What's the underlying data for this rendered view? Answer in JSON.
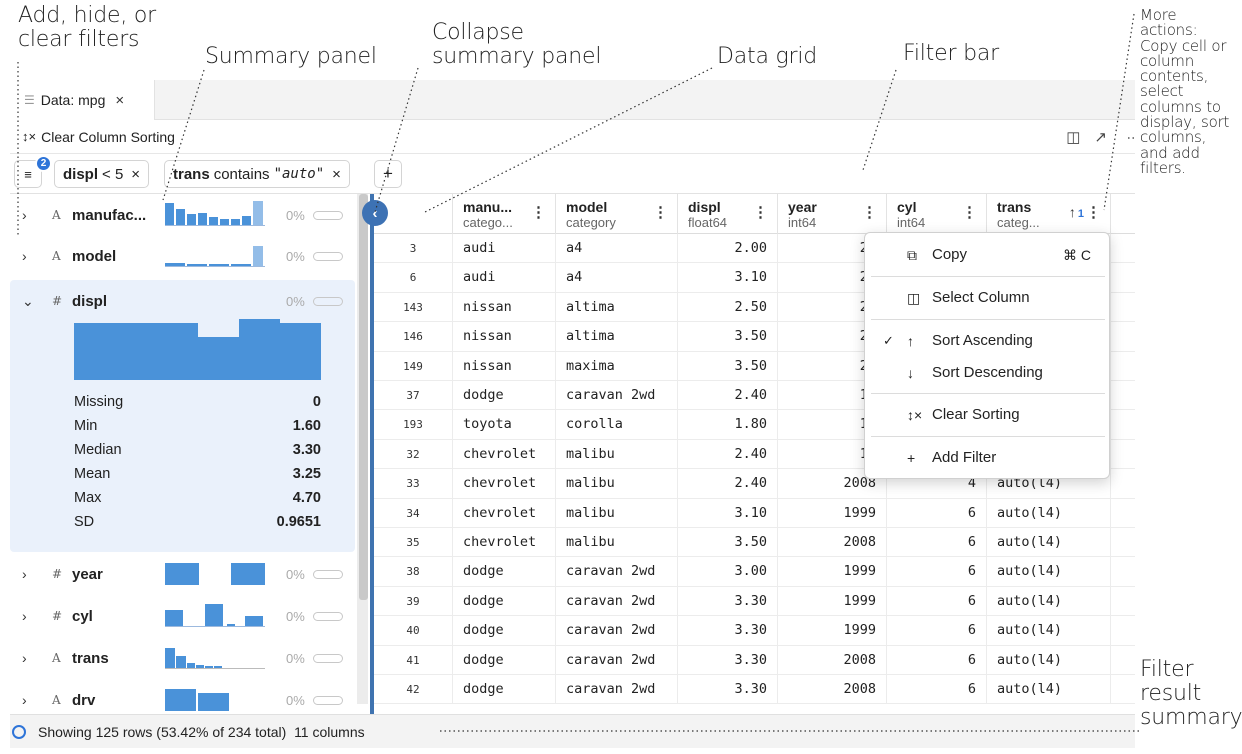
{
  "annotations": {
    "add_hide_filters": [
      "Add, hide, or",
      "clear filters"
    ],
    "summary_panel": "Summary panel",
    "collapse_summary": [
      "Collapse",
      "summary panel"
    ],
    "data_grid": "Data grid",
    "filter_bar": "Filter bar",
    "more_actions": [
      "More",
      "actions:",
      "Copy cell or",
      "column",
      "contents,",
      "select",
      "columns to",
      "display, sort",
      "columns,",
      "and add",
      "filters."
    ],
    "filter_result_summary": [
      "Filter",
      "result",
      "summary"
    ]
  },
  "tab": {
    "icon": "table-icon",
    "label": "Data: mpg",
    "close": "×"
  },
  "toolbar": {
    "clear_sorting_icon": "↕×",
    "clear_sorting_label": "Clear Column Sorting",
    "split_icon": "◫",
    "popout_icon": "↗"
  },
  "filter_bar": {
    "filter_count": "2",
    "filters": [
      {
        "column": "displ",
        "rest": "< 5",
        "value": ""
      },
      {
        "column": "trans",
        "rest": "contains",
        "value": "\"auto\""
      }
    ],
    "remove": "×",
    "add": "+"
  },
  "summary": {
    "columns": [
      {
        "name": "manufac...",
        "type": "A",
        "missing": "0%",
        "chevron": "›"
      },
      {
        "name": "model",
        "type": "A",
        "missing": "0%",
        "chevron": "›"
      },
      {
        "name": "displ",
        "type": "#",
        "missing": "0%",
        "chevron": "⌄"
      },
      {
        "name": "year",
        "type": "#",
        "missing": "0%",
        "chevron": "›"
      },
      {
        "name": "cyl",
        "type": "#",
        "missing": "0%",
        "chevron": "›"
      },
      {
        "name": "trans",
        "type": "A",
        "missing": "0%",
        "chevron": "›"
      },
      {
        "name": "drv",
        "type": "A",
        "missing": "0%",
        "chevron": "›"
      }
    ],
    "displ_histogram": [
      0.62,
      0.62,
      0.62,
      0.47,
      0.67,
      0.62
    ],
    "displ_stats": [
      {
        "label": "Missing",
        "value": "0"
      },
      {
        "label": "Min",
        "value": "1.60"
      },
      {
        "label": "Median",
        "value": "3.30"
      },
      {
        "label": "Mean",
        "value": "3.25"
      },
      {
        "label": "Max",
        "value": "4.70"
      },
      {
        "label": "SD",
        "value": "0.9651"
      }
    ]
  },
  "grid": {
    "columns": [
      {
        "name": "manu...",
        "type": "catego...",
        "menu": "⋮"
      },
      {
        "name": "model",
        "type": "category",
        "menu": "⋮"
      },
      {
        "name": "displ",
        "type": "float64",
        "menu": "⋮"
      },
      {
        "name": "year",
        "type": "int64",
        "menu": "⋮"
      },
      {
        "name": "cyl",
        "type": "int64",
        "menu": "⋮"
      },
      {
        "name": "trans",
        "type": "categ...",
        "menu": "⋮",
        "sort": "↑",
        "sort_rank": "1"
      }
    ],
    "rows": [
      [
        "3",
        "audi",
        "a4",
        "2.00",
        "20",
        "",
        ""
      ],
      [
        "6",
        "audi",
        "a4",
        "3.10",
        "20",
        "",
        ""
      ],
      [
        "143",
        "nissan",
        "altima",
        "2.50",
        "20",
        "",
        ""
      ],
      [
        "146",
        "nissan",
        "altima",
        "3.50",
        "20",
        "",
        ""
      ],
      [
        "149",
        "nissan",
        "maxima",
        "3.50",
        "20",
        "",
        ""
      ],
      [
        "37",
        "dodge",
        "caravan 2wd",
        "2.40",
        "19",
        "",
        ""
      ],
      [
        "193",
        "toyota",
        "corolla",
        "1.80",
        "19",
        "",
        ""
      ],
      [
        "32",
        "chevrolet",
        "malibu",
        "2.40",
        "19",
        "",
        ""
      ],
      [
        "33",
        "chevrolet",
        "malibu",
        "2.40",
        "2008",
        "4",
        "auto(l4)"
      ],
      [
        "34",
        "chevrolet",
        "malibu",
        "3.10",
        "1999",
        "6",
        "auto(l4)"
      ],
      [
        "35",
        "chevrolet",
        "malibu",
        "3.50",
        "2008",
        "6",
        "auto(l4)"
      ],
      [
        "38",
        "dodge",
        "caravan 2wd",
        "3.00",
        "1999",
        "6",
        "auto(l4)"
      ],
      [
        "39",
        "dodge",
        "caravan 2wd",
        "3.30",
        "1999",
        "6",
        "auto(l4)"
      ],
      [
        "40",
        "dodge",
        "caravan 2wd",
        "3.30",
        "1999",
        "6",
        "auto(l4)"
      ],
      [
        "41",
        "dodge",
        "caravan 2wd",
        "3.30",
        "2008",
        "6",
        "auto(l4)"
      ],
      [
        "42",
        "dodge",
        "caravan 2wd",
        "3.30",
        "2008",
        "6",
        "auto(l4)"
      ]
    ]
  },
  "context_menu": {
    "copy": {
      "icon": "copy-icon",
      "label": "Copy",
      "shortcut": "⌘ C"
    },
    "select_column": {
      "icon": "column-icon",
      "label": "Select Column"
    },
    "sort_ascending": {
      "check": "✓",
      "icon": "↑",
      "label": "Sort Ascending"
    },
    "sort_descending": {
      "icon": "↓",
      "label": "Sort Descending"
    },
    "clear_sorting": {
      "icon": "↕×",
      "label": "Clear Sorting"
    },
    "add_filter": {
      "icon": "+",
      "label": "Add Filter"
    }
  },
  "status": {
    "prefix": "Showing",
    "rows": "125",
    "rows_word": "rows (53.42% of",
    "total": "234",
    "total_word": "total)",
    "columns": "11",
    "columns_word": "columns"
  }
}
